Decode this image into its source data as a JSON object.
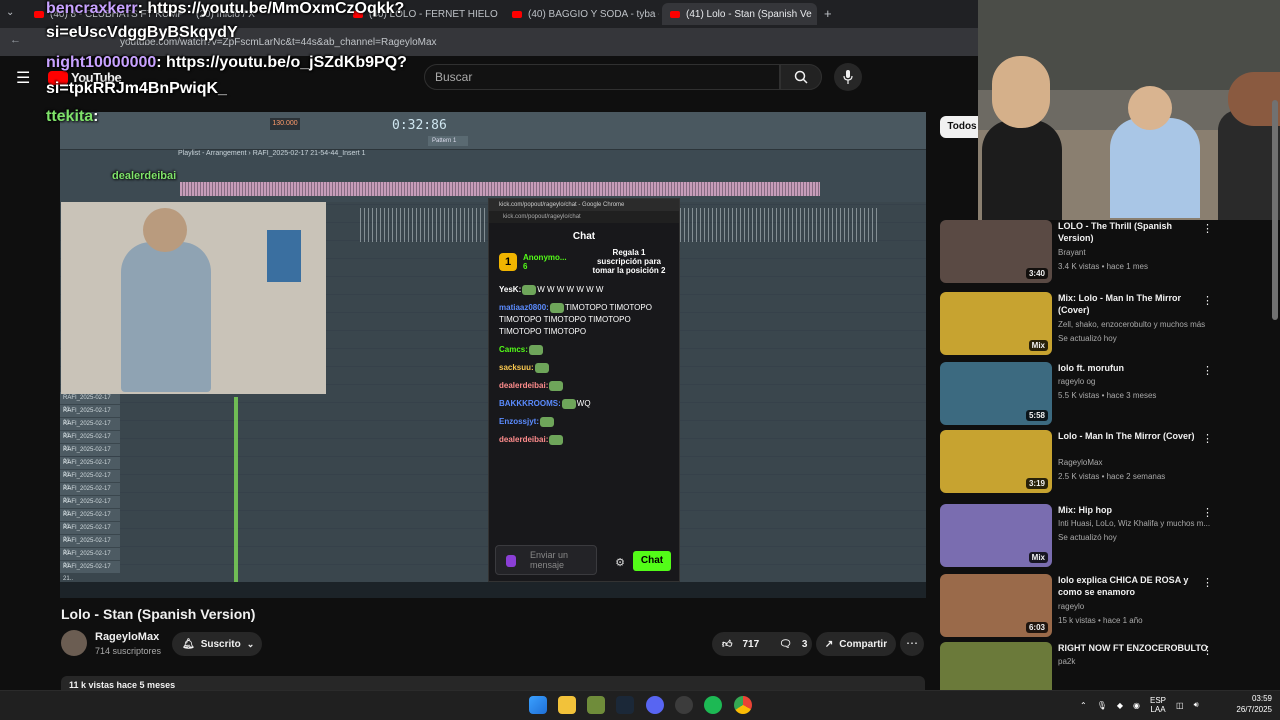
{
  "browser": {
    "tabs": [
      {
        "label": "(40) 8 - CLUBHATS FT KUMP"
      },
      {
        "label": "(20) Inicio / X"
      },
      {
        "label": "(40) LOLO - FERNET HIELO (VID"
      },
      {
        "label": "(40) BAGGIO Y SODA - tyba - Y"
      },
      {
        "label": "(41) Lolo - Stan (Spanish Ve"
      }
    ],
    "url": "youtube.com/watch?v=ZpFscmLarNc&t=44s&ab_channel=RageyloMax"
  },
  "youtube": {
    "logo_text": "YouTube",
    "search_placeholder": "Buscar"
  },
  "stream_overlay": {
    "lines": [
      {
        "user": "bencraxkerr",
        "text": ": https://youtu.be/MmOxmCzOqkk?"
      },
      {
        "user": "",
        "text": "si=eUscVdggByBSkqydY"
      },
      {
        "user": "night10000000",
        "text": ": https://youtu.be/o_jSZdKb9PQ?"
      },
      {
        "user": "",
        "text": "si=tpkRRJm4BnPwiqK_"
      },
      {
        "user": "ttekita",
        "text": ":"
      },
      {
        "user": "dealerdeibai",
        "text": ""
      }
    ]
  },
  "player": {
    "fl_timer": "0:32:86",
    "fl_tempo": "130.000",
    "playlist_title": "Playlist - Arrangement › RAFI_2025-02-17 21-54-44_Insert 1",
    "pattern": "Pattern 1",
    "track_labels": [
      "RAFI_2025-02-17 21..",
      "RAFI_2025-02-17 21..",
      "RAFI_2025-02-17 21..",
      "RAFI_2025-02-17 21..",
      "RAFI_2025-02-17 21..",
      "RAFI_2025-02-17 21..",
      "RAFI_2025-02-17 21..",
      "RAFI_2025-02-17 21..",
      "RAFI_2025-02-17 21..",
      "RAFI_2025-02-17 21..",
      "RAFI_2025-02-17 21..",
      "RAFI_2025-02-17 21..",
      "RAFI_2025-02-17 21..",
      "RAFI_2025-02-17 21.."
    ]
  },
  "kick_chat": {
    "window_title": "kick.com/popout/rageylo/chat - Google Chrome",
    "url": "kick.com/popout/rageylo/chat",
    "heading": "Chat",
    "sub_user": "Anonymo...",
    "sub_count": "6",
    "sub_promo": "Regala 1 suscripción para tomar la posición 2",
    "messages": [
      {
        "user": "YesK:",
        "text": "W W W W W W W",
        "color": "#ffffff"
      },
      {
        "user": "matiaaz0800:",
        "text": "TIMOTOPO TIMOTOPO TIMOTOPO TIMOTOPO TIMOTOPO TIMOTOPO TIMOTOPO",
        "color": "#5b8cff"
      },
      {
        "user": "Camcs:",
        "text": "",
        "color": "#53fc18"
      },
      {
        "user": "sacksuu:",
        "text": "",
        "color": "#f9c74f"
      },
      {
        "user": "dealerdeibai:",
        "text": "",
        "color": "#ff8c8c"
      },
      {
        "user": "BAKKKROOMS:",
        "text": "WQ",
        "color": "#5b8cff"
      },
      {
        "user": "Enzossjyt:",
        "text": "",
        "color": "#5b8cff"
      },
      {
        "user": "dealerdeibai:",
        "text": "",
        "color": "#ff8c8c"
      }
    ],
    "input_placeholder": "Enviar un mensaje",
    "send_label": "Chat"
  },
  "video": {
    "title": "Lolo - Stan (Spanish Version)",
    "channel": "RageyloMax",
    "subscribers": "714 suscriptores",
    "subscribe_state": "Suscrito",
    "likes": "717",
    "comments": "3",
    "share_label": "Compartir",
    "views": "11 k vistas  hace 5 meses"
  },
  "sidebar": {
    "chip": "Todos",
    "recommendations": [
      {
        "title": "LOLO - The Thrill (Spanish Version)",
        "channel": "Brayant",
        "stats": "3.4 K vistas • hace 1 mes",
        "duration": "3:40",
        "thumb_color": "#5a4a44"
      },
      {
        "title": "Mix: Lolo - Man In The Mirror (Cover)",
        "channel": "Zell, shako, enzocerobulto y muchos más",
        "stats": "Se actualizó hoy",
        "duration": "Mix",
        "thumb_color": "#c7a330"
      },
      {
        "title": "lolo ft. morufun",
        "channel": "rageylo og",
        "stats": "5.5 K vistas • hace 3 meses",
        "duration": "5:58",
        "thumb_color": "#3c6a80"
      },
      {
        "title": "Lolo - Man In The Mirror (Cover)",
        "channel": "RageyloMax",
        "stats": "2.5 K vistas • hace 2 semanas",
        "duration": "3:19",
        "thumb_color": "#c7a330"
      },
      {
        "title": "Mix: Hip hop",
        "channel": "Inti Huasi, LoLo, Wiz Khalifa y muchos m...",
        "stats": "Se actualizó hoy",
        "duration": "Mix",
        "thumb_color": "#7a6db0"
      },
      {
        "title": "lolo explica CHICA DE ROSA y como se enamoro",
        "channel": "rageylo",
        "stats": "15 k vistas • hace 1 año",
        "duration": "6:03",
        "thumb_color": "#9a6a4a"
      },
      {
        "title": "RIGHT NOW FT ENZOCEROBULTO",
        "channel": "pa2k",
        "stats": "",
        "duration": "",
        "thumb_color": "#6b7a3a"
      }
    ]
  },
  "taskbar": {
    "lang_top": "ESP",
    "lang_bottom": "LAA",
    "time": "03:59",
    "date": "26/7/2025"
  }
}
